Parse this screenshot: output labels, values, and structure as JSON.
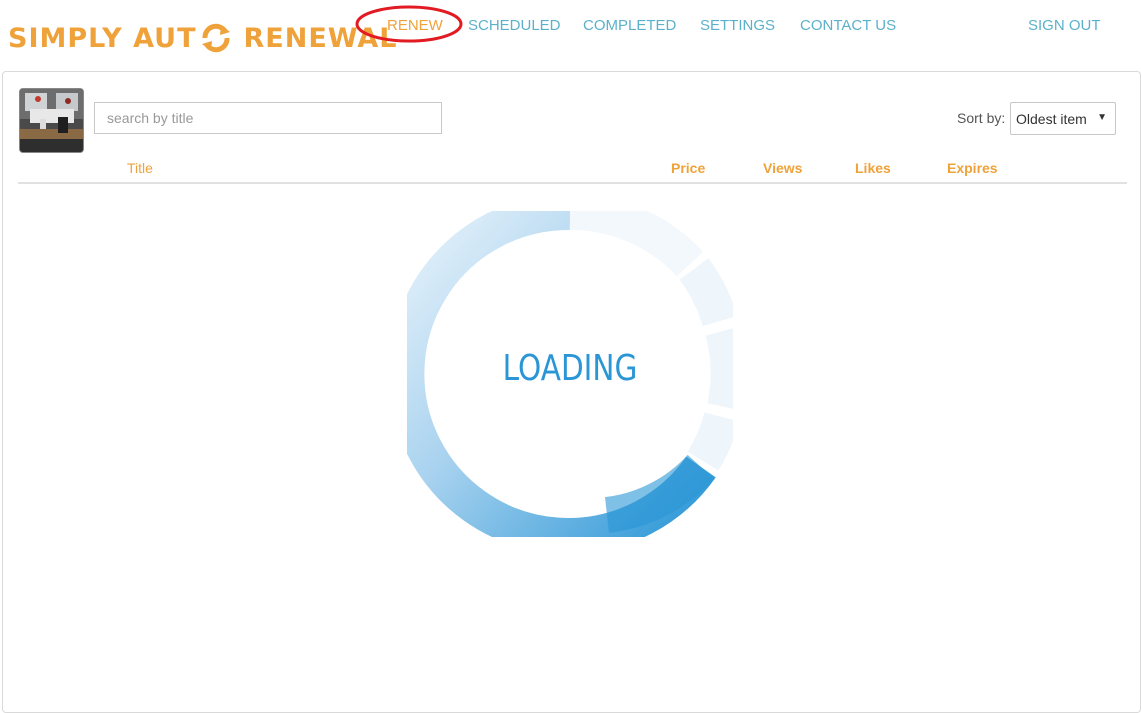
{
  "header": {
    "logo_pre": "SIMPLY AUT",
    "logo_post": "RENEWAL",
    "logo_icon": "refresh-arrows-icon",
    "nav": {
      "renew": "RENEW",
      "scheduled": "SCHEDULED",
      "completed": "COMPLETED",
      "settings": "SETTINGS",
      "contact": "CONTACT US",
      "signout": "SIGN OUT"
    },
    "active_tab": "RENEW",
    "highlight_color": "#e21b23"
  },
  "toolbar": {
    "search_placeholder": "search by title",
    "sort_label": "Sort by:",
    "sort_value": "Oldest item"
  },
  "table": {
    "columns": [
      "Title",
      "Price",
      "Views",
      "Likes",
      "Expires"
    ]
  },
  "loading": {
    "text": "LOADING"
  },
  "colors": {
    "brand_orange": "#f0a23a",
    "nav_teal": "#5bb1c9",
    "loading_blue": "#2a96d6"
  }
}
